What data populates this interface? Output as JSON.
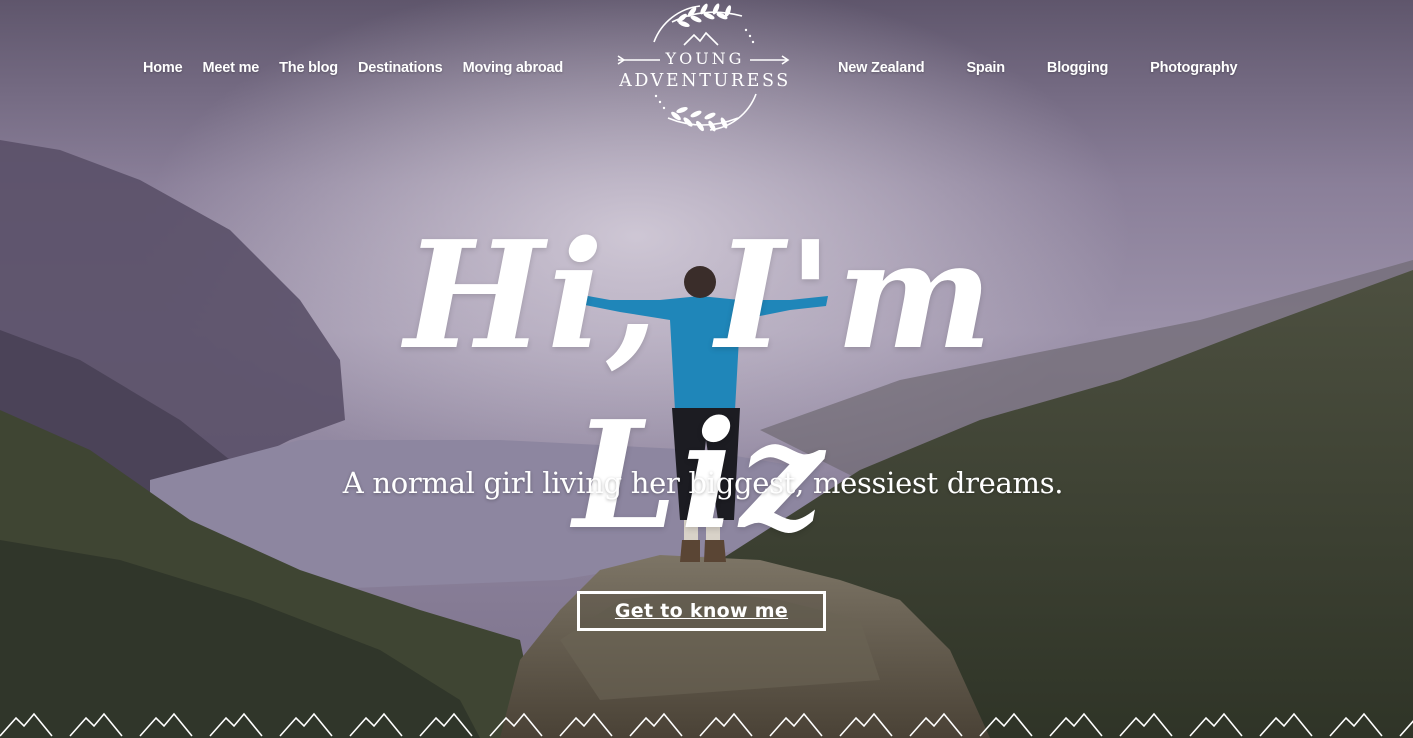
{
  "nav": {
    "left": [
      {
        "label": "Home"
      },
      {
        "label": "Meet me"
      },
      {
        "label": "The blog"
      },
      {
        "label": "Destinations"
      },
      {
        "label": "Moving abroad"
      }
    ],
    "right": [
      {
        "label": "New Zealand"
      },
      {
        "label": "Spain"
      },
      {
        "label": "Blogging"
      },
      {
        "label": "Photography"
      }
    ]
  },
  "logo": {
    "line1": "YOUNG",
    "line2": "ADVENTURESS",
    "icon": "laurel-arrow-mountain-logo"
  },
  "hero": {
    "title": "Hi, I'm Liz",
    "tagline": "A normal girl living her biggest, messiest dreams.",
    "cta_label": "Get to know me"
  },
  "colors": {
    "text": "#ffffff",
    "sky": "#8a7f9c",
    "mountain_dark": "#3e4534",
    "lake": "#7d7590"
  }
}
